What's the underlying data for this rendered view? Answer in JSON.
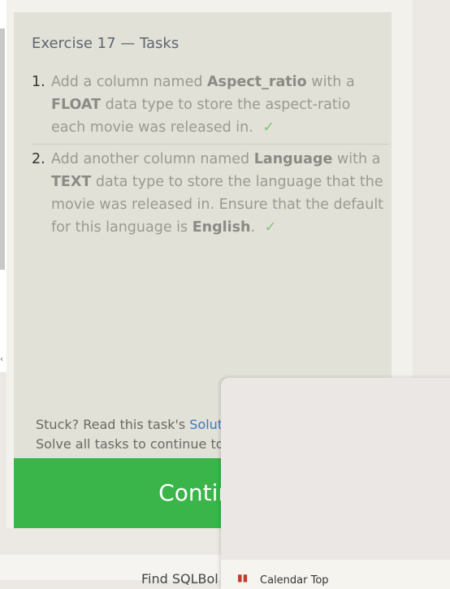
{
  "exercise": {
    "title": "Exercise 17 — Tasks"
  },
  "tasks": [
    {
      "number": "1.",
      "parts": [
        "Add a column named ",
        "Aspect_ratio",
        " with a ",
        "FLOAT",
        " data type to store the aspect-ratio each movie was released in."
      ],
      "done": "✓"
    },
    {
      "number": "2.",
      "parts": [
        "Add another column named ",
        "Language",
        " with a ",
        "TEXT",
        " data type to store the language that the movie was released in. Ensure that the default for this language is ",
        "English",
        "."
      ],
      "done": "✓"
    }
  ],
  "help": {
    "line1_prefix": "Stuck? Read this task's ",
    "line1_link": "Solution",
    "line2": "Solve all tasks to continue to th"
  },
  "continue_label": "Continu",
  "footer": {
    "link": "Find SQLBol"
  },
  "popup": {
    "footer_text": "Calendar Top"
  }
}
